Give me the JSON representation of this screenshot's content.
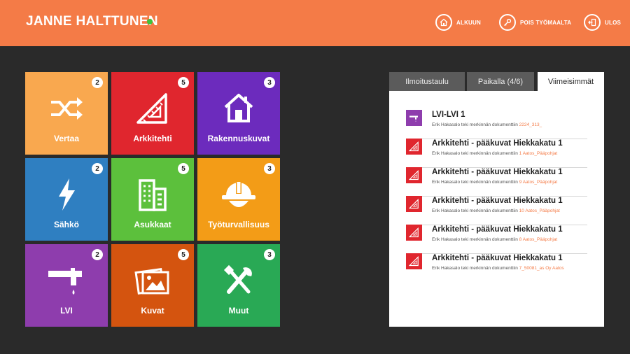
{
  "header": {
    "user_name": "JANNE HALTTUNEN",
    "nav": [
      {
        "label": "ALKUUN",
        "icon": "home-icon"
      },
      {
        "label": "POIS TYÖMAALTA",
        "icon": "key-icon"
      },
      {
        "label": "ULOS",
        "icon": "exit-icon"
      }
    ]
  },
  "tiles": [
    {
      "label": "Vertaa",
      "badge": "2",
      "color": "#f9a84f",
      "icon": "shuffle-icon"
    },
    {
      "label": "Arkkitehti",
      "badge": "5",
      "color": "#e0262e",
      "icon": "set-square-icon"
    },
    {
      "label": "Rakennuskuvat",
      "badge": "3",
      "color": "#6c2bbd",
      "icon": "house-icon"
    },
    {
      "label": "Sähkö",
      "badge": "2",
      "color": "#2f7fc1",
      "icon": "lightning-icon"
    },
    {
      "label": "Asukkaat",
      "badge": "5",
      "color": "#5cc03c",
      "icon": "building-icon"
    },
    {
      "label": "Työturvallisuus",
      "badge": "3",
      "color": "#f39c17",
      "icon": "hard-hat-icon"
    },
    {
      "label": "LVI",
      "badge": "2",
      "color": "#8e3dad",
      "icon": "faucet-icon"
    },
    {
      "label": "Kuvat",
      "badge": "5",
      "color": "#d4540f",
      "icon": "photos-icon"
    },
    {
      "label": "Muut",
      "badge": "3",
      "color": "#29a955",
      "icon": "tools-icon"
    }
  ],
  "panel": {
    "tabs": [
      "Ilmoitustaulu",
      "Paikalla (4/6)",
      "Viimeisimmät"
    ],
    "active_tab": "Viimeisimmät",
    "items": [
      {
        "title": "LVI-LVI 1",
        "desc": "Erik Hakasalo teki merkinnän dokumenttiin ",
        "link": "2224_313_",
        "thumb_color": "#8e3dad",
        "icon": "faucet-icon"
      },
      {
        "title": "Arkkitehti - pääkuvat Hiekkakatu 1",
        "desc": "Erik Hakasalo teki merkinnän dokumenttiin ",
        "link": "1 Aatos_Pääpohjat",
        "thumb_color": "#e0262e",
        "icon": "set-square-icon"
      },
      {
        "title": "Arkkitehti - pääkuvat Hiekkakatu 1",
        "desc": "Erik Hakasalo teki merkinnän dokumenttiin ",
        "link": "9 Aatos_Pääpohjat",
        "thumb_color": "#e0262e",
        "icon": "set-square-icon"
      },
      {
        "title": "Arkkitehti - pääkuvat Hiekkakatu 1",
        "desc": "Erik Hakasalo teki merkinnän dokumenttiin ",
        "link": "10 Aatos_Pääpohjat",
        "thumb_color": "#e0262e",
        "icon": "set-square-icon"
      },
      {
        "title": "Arkkitehti - pääkuvat Hiekkakatu 1",
        "desc": "Erik Hakasalo teki merkinnän dokumenttiin ",
        "link": "8 Aatos_Pääpohjat",
        "thumb_color": "#e0262e",
        "icon": "set-square-icon"
      },
      {
        "title": "Arkkitehti - pääkuvat Hiekkakatu 1",
        "desc": "Erik Hakasalo teki merkinnän dokumenttiin ",
        "link": "7_50081_as Oy Aatos",
        "thumb_color": "#e0262e",
        "icon": "set-square-icon"
      }
    ]
  },
  "colors": {
    "header": "#f47b47",
    "background": "#2a2a2a",
    "online": "#3cc33c",
    "link": "#f47b47"
  }
}
